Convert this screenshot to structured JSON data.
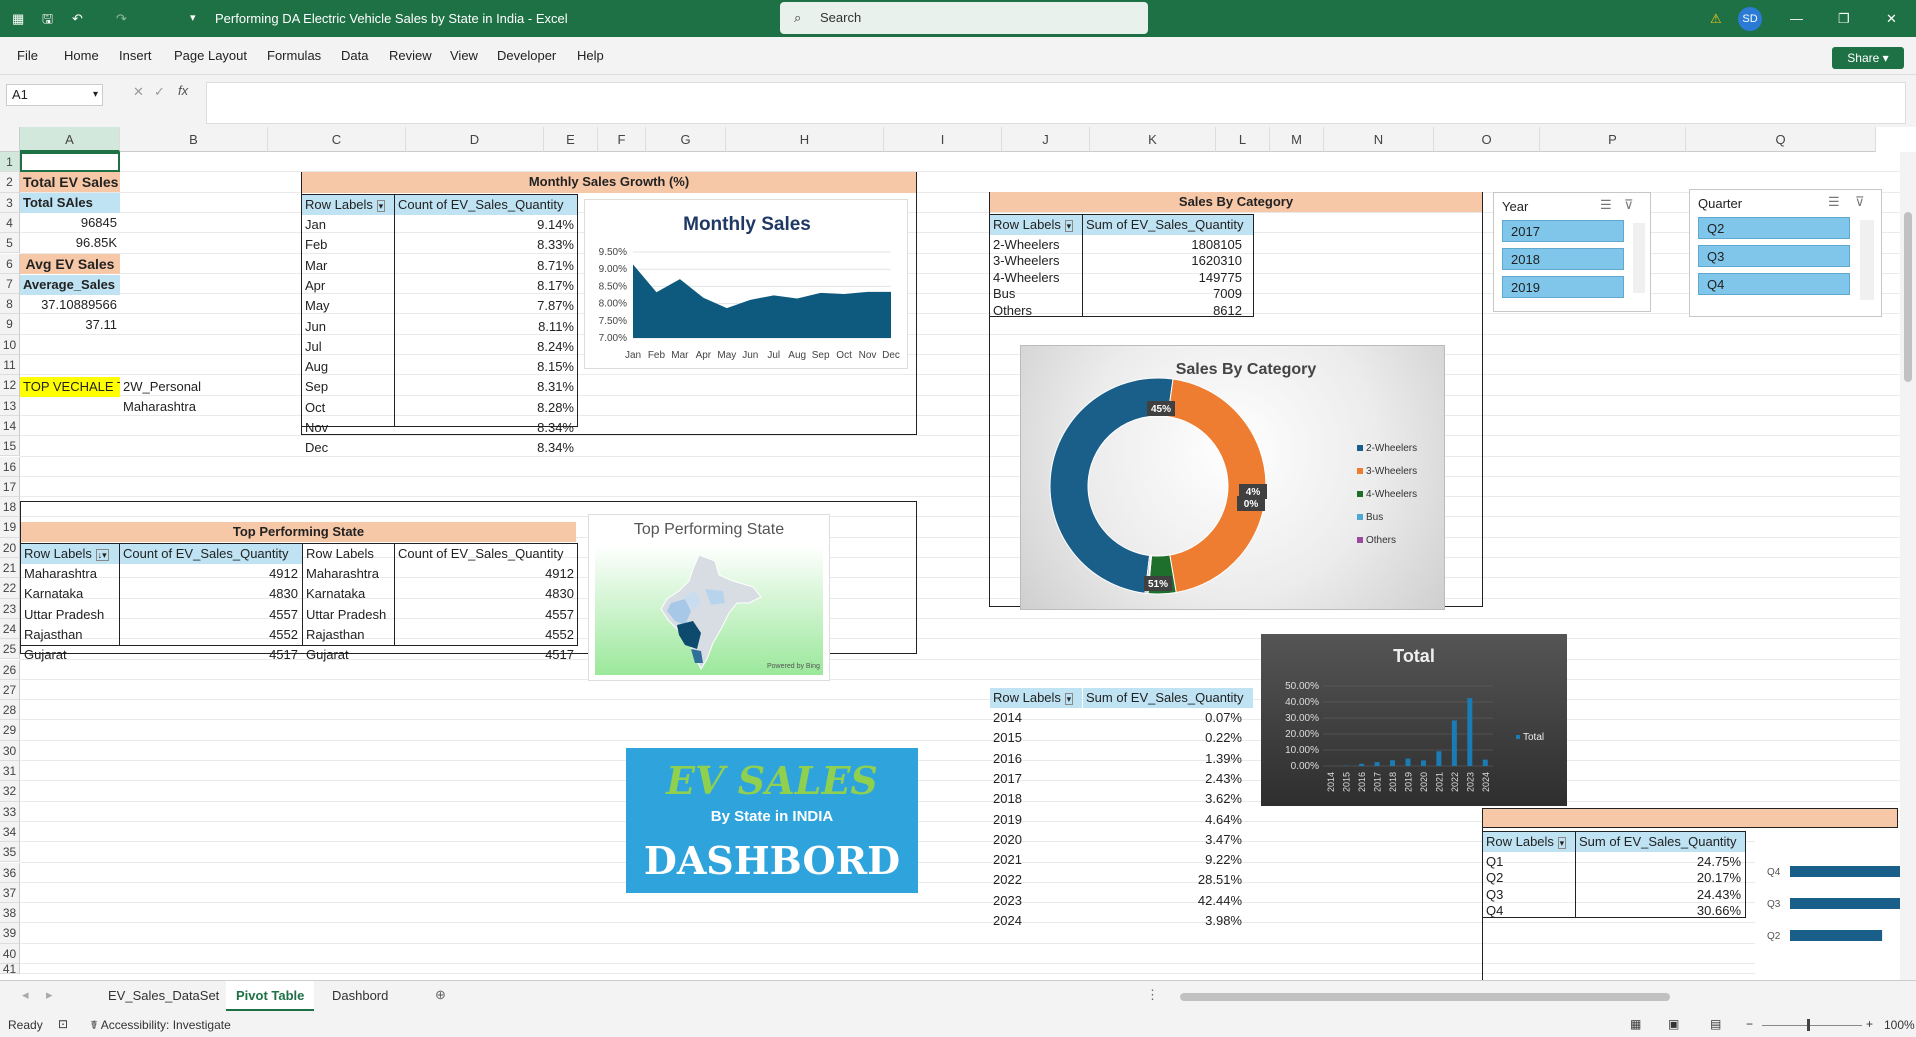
{
  "window": {
    "title": "Performing DA Electric Vehicle Sales by State in India  -  Excel",
    "search_placeholder": "Search",
    "user_initials": "SD",
    "share_label": "Share"
  },
  "menu": [
    "File",
    "Home",
    "Insert",
    "Page Layout",
    "Formulas",
    "Data",
    "Review",
    "View",
    "Developer",
    "Help"
  ],
  "formula_bar": {
    "name_box": "A1",
    "fx": "fx",
    "content": ""
  },
  "columns": [
    "A",
    "B",
    "C",
    "D",
    "E",
    "F",
    "G",
    "H",
    "I",
    "J",
    "K",
    "L",
    "M",
    "N",
    "O",
    "P",
    "Q"
  ],
  "rows": [
    "1",
    "2",
    "3",
    "4",
    "5",
    "6",
    "7",
    "8",
    "9",
    "10",
    "11",
    "12",
    "13",
    "14",
    "15",
    "16",
    "17",
    "18",
    "19",
    "20",
    "21",
    "22",
    "23",
    "24",
    "25",
    "26",
    "27",
    "28",
    "29",
    "30",
    "31",
    "32",
    "33",
    "34",
    "35",
    "36",
    "37",
    "38",
    "39",
    "40",
    "41"
  ],
  "left_block": {
    "total_ev_title": "Total EV Sales",
    "total_sales_label": "Total SAles",
    "total_sales_value": "96845",
    "total_sales_k": "96.85K",
    "avg_title": "Avg EV Sales",
    "avg_label": "Average_Sales",
    "avg_value": "37.10889566",
    "avg_rounded": "37.11",
    "top_vehicle_label": "TOP VECHALE T",
    "top_vehicle_value": "2W_Personal",
    "top_state_value": "Maharashtra"
  },
  "monthly_growth": {
    "title": "Monthly Sales Growth (%)",
    "col1": "Row Labels",
    "col2": "Count of EV_Sales_Quantity",
    "rows": [
      [
        "Jan",
        "9.14%"
      ],
      [
        "Feb",
        "8.33%"
      ],
      [
        "Mar",
        "8.71%"
      ],
      [
        "Apr",
        "8.17%"
      ],
      [
        "May",
        "7.87%"
      ],
      [
        "Jun",
        "8.11%"
      ],
      [
        "Jul",
        "8.24%"
      ],
      [
        "Aug",
        "8.15%"
      ],
      [
        "Sep",
        "8.31%"
      ],
      [
        "Oct",
        "8.28%"
      ],
      [
        "Nov",
        "8.34%"
      ],
      [
        "Dec",
        "8.34%"
      ]
    ]
  },
  "chart_data": [
    {
      "type": "area",
      "title": "Monthly Sales",
      "categories": [
        "Jan",
        "Feb",
        "Mar",
        "Apr",
        "May",
        "Jun",
        "Jul",
        "Aug",
        "Sep",
        "Oct",
        "Nov",
        "Dec"
      ],
      "values": [
        9.14,
        8.33,
        8.71,
        8.17,
        7.87,
        8.11,
        8.24,
        8.15,
        8.31,
        8.28,
        8.34,
        8.34
      ],
      "yticks": [
        "9.50%",
        "9.00%",
        "8.50%",
        "8.00%",
        "7.50%",
        "7.00%"
      ],
      "ylim": [
        7.0,
        9.5
      ],
      "color": "#0e5a7e"
    },
    {
      "type": "pie",
      "title": "Sales By Category",
      "categories": [
        "2-Wheelers",
        "3-Wheelers",
        "4-Wheelers",
        "Bus",
        "Others"
      ],
      "values": [
        1808105,
        1620310,
        149775,
        7009,
        8612
      ],
      "data_labels": [
        "51%",
        "45%",
        "4%",
        "0%"
      ],
      "colors": [
        "#1a5f8a",
        "#ee7d31",
        "#1e6f2c",
        "#4ea8d6",
        "#9b4aa0"
      ]
    },
    {
      "type": "bar",
      "title": "Total",
      "categories": [
        "2014",
        "2015",
        "2016",
        "2017",
        "2018",
        "2019",
        "2020",
        "2021",
        "2022",
        "2023",
        "2024"
      ],
      "values": [
        0.07,
        0.22,
        1.39,
        2.43,
        3.62,
        4.64,
        3.47,
        9.22,
        28.51,
        42.44,
        3.98
      ],
      "yticks": [
        "50.00%",
        "40.00%",
        "30.00%",
        "20.00%",
        "10.00%",
        "0.00%"
      ],
      "ylim": [
        0,
        50
      ],
      "legend": "Total",
      "color": "#1a7bb5"
    },
    {
      "type": "bar",
      "categories": [
        "Q2",
        "Q3",
        "Q4"
      ],
      "values": [
        20.17,
        24.43,
        30.66
      ],
      "color": "#1a5f8a"
    }
  ],
  "category_table": {
    "title": "Sales By Category",
    "col1": "Row Labels",
    "col2": "Sum of EV_Sales_Quantity",
    "rows": [
      [
        "2-Wheelers",
        "1808105"
      ],
      [
        "3-Wheelers",
        "1620310"
      ],
      [
        "4-Wheelers",
        "149775"
      ],
      [
        "Bus",
        "7009"
      ],
      [
        "Others",
        "8612"
      ]
    ]
  },
  "slicers": {
    "year": {
      "title": "Year",
      "items": [
        "2017",
        "2018",
        "2019"
      ]
    },
    "quarter": {
      "title": "Quarter",
      "items": [
        "Q2",
        "Q3",
        "Q4"
      ]
    }
  },
  "top_state": {
    "title": "Top Performing State",
    "col1": "Row Labels",
    "col2": "Count of EV_Sales_Quantity",
    "rows": [
      [
        "Maharashtra",
        "4912"
      ],
      [
        "Karnataka",
        "4830"
      ],
      [
        "Uttar Pradesh",
        "4557"
      ],
      [
        "Rajasthan",
        "4552"
      ],
      [
        "Gujarat",
        "4517"
      ]
    ],
    "map_title": "Top Performing State",
    "map_credit": "Powered by Bing"
  },
  "year_table": {
    "col1": "Row Labels",
    "col2": "Sum of EV_Sales_Quantity",
    "rows": [
      [
        "2014",
        "0.07%"
      ],
      [
        "2015",
        "0.22%"
      ],
      [
        "2016",
        "1.39%"
      ],
      [
        "2017",
        "2.43%"
      ],
      [
        "2018",
        "3.62%"
      ],
      [
        "2019",
        "4.64%"
      ],
      [
        "2020",
        "3.47%"
      ],
      [
        "2021",
        "9.22%"
      ],
      [
        "2022",
        "28.51%"
      ],
      [
        "2023",
        "42.44%"
      ],
      [
        "2024",
        "3.98%"
      ]
    ]
  },
  "quarter_table": {
    "col1": "Row Labels",
    "col2": "Sum of EV_Sales_Quantity",
    "rows": [
      [
        "Q1",
        "24.75%"
      ],
      [
        "Q2",
        "20.17%"
      ],
      [
        "Q3",
        "24.43%"
      ],
      [
        "Q4",
        "30.66%"
      ]
    ]
  },
  "banner": {
    "line1": "EV SALES",
    "line2": "By State in INDIA",
    "line3": "DASHBORD"
  },
  "sheets": [
    "EV_Sales_DataSet",
    "Pivot Table",
    "Dashbord"
  ],
  "active_sheet": "Pivot Table",
  "status": {
    "ready": "Ready",
    "accessibility": "Accessibility: Investigate",
    "zoom": "100%"
  }
}
